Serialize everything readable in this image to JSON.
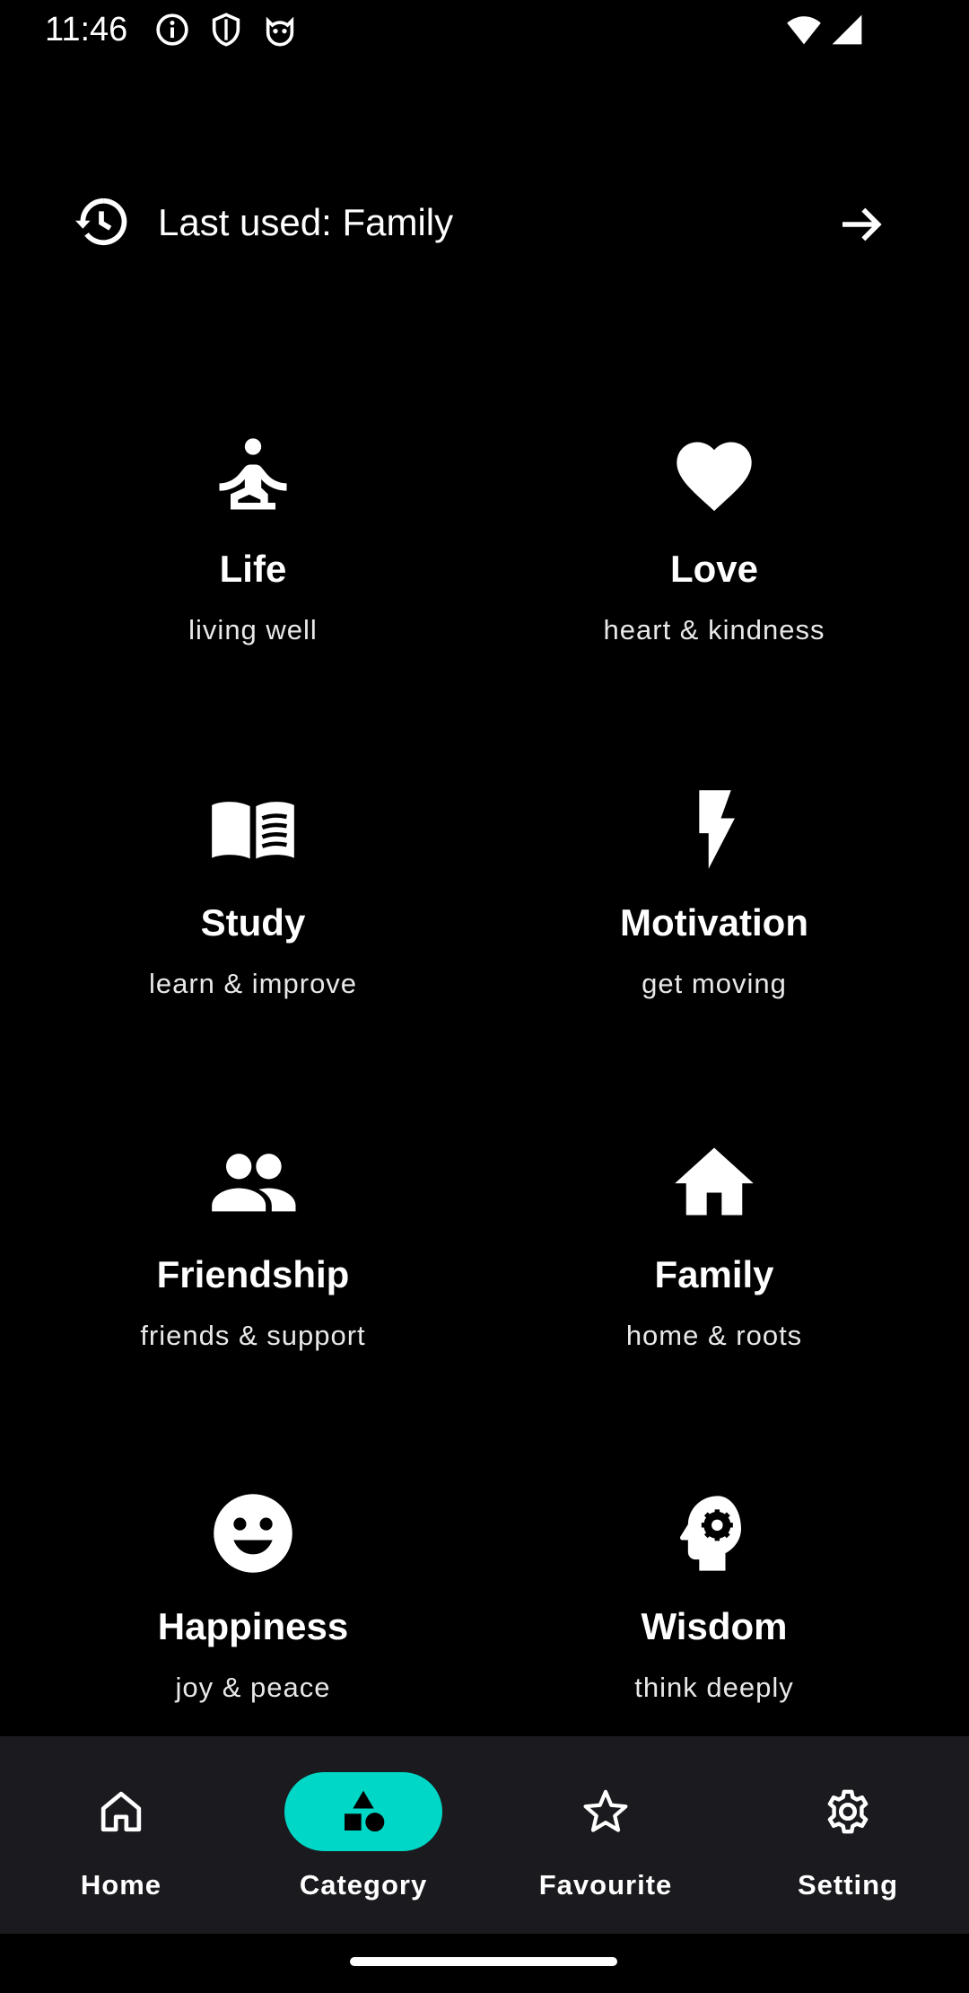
{
  "status_bar": {
    "time": "11:46",
    "icons_left": [
      "info-icon",
      "shield-icon",
      "cat-face-icon"
    ],
    "icons_right": [
      "wifi-icon",
      "signal-icon"
    ]
  },
  "last_used": {
    "label": "Last used: Family",
    "icon": "history-icon",
    "action_icon": "arrow-right-icon"
  },
  "categories": [
    {
      "title": "Life",
      "subtitle": "living well",
      "icon": "meditation-icon"
    },
    {
      "title": "Love",
      "subtitle": "heart & kindness",
      "icon": "heart-icon"
    },
    {
      "title": "Study",
      "subtitle": "learn & improve",
      "icon": "book-icon"
    },
    {
      "title": "Motivation",
      "subtitle": "get moving",
      "icon": "bolt-icon"
    },
    {
      "title": "Friendship",
      "subtitle": "friends & support",
      "icon": "people-icon"
    },
    {
      "title": "Family",
      "subtitle": "home & roots",
      "icon": "home-icon"
    },
    {
      "title": "Happiness",
      "subtitle": "joy & peace",
      "icon": "smile-icon"
    },
    {
      "title": "Wisdom",
      "subtitle": "think deeply",
      "icon": "head-gear-icon"
    }
  ],
  "bottom_nav": {
    "items": [
      {
        "label": "Home",
        "icon": "home-outline-icon",
        "selected": false
      },
      {
        "label": "Category",
        "icon": "category-icon",
        "selected": true
      },
      {
        "label": "Favourite",
        "icon": "star-outline-icon",
        "selected": false
      },
      {
        "label": "Setting",
        "icon": "gear-icon",
        "selected": false
      }
    ],
    "selected_color": "#00d7c6",
    "background": "#1b1b1f"
  }
}
